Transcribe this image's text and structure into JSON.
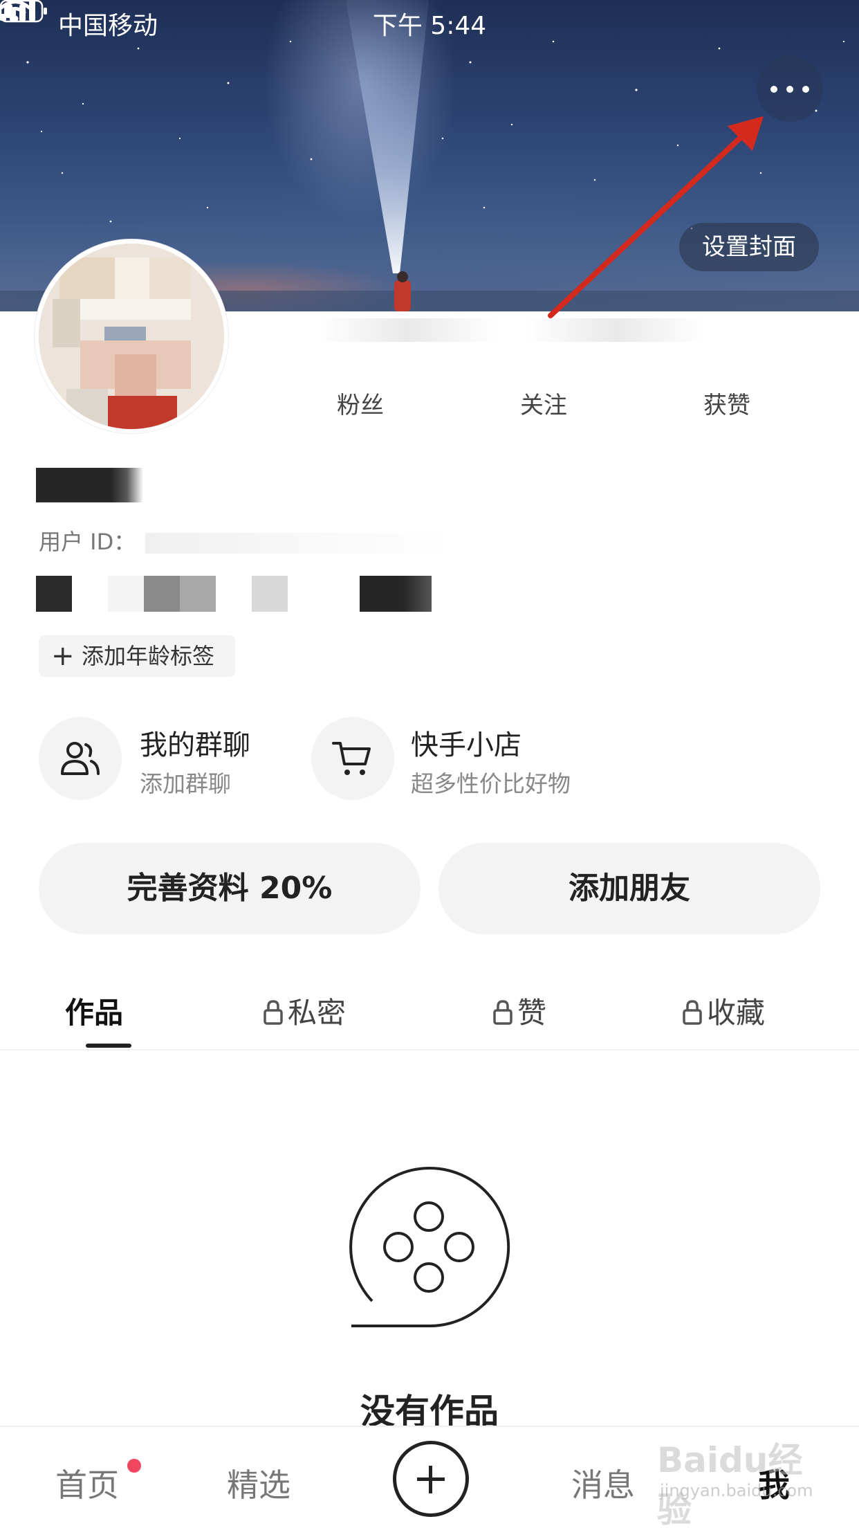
{
  "status_bar": {
    "carrier": "中国移动",
    "time": "下午 5:44"
  },
  "cover": {
    "set_cover_label": "设置封面"
  },
  "profile": {
    "stats": [
      {
        "label": "粉丝"
      },
      {
        "label": "关注"
      },
      {
        "label": "获赞"
      }
    ],
    "user_id_label": "用户 ID：",
    "add_age_tag": "添加年龄标签"
  },
  "entries": [
    {
      "title": "我的群聊",
      "subtitle": "添加群聊",
      "icon": "group-icon"
    },
    {
      "title": "快手小店",
      "subtitle": "超多性价比好物",
      "icon": "cart-icon"
    }
  ],
  "buttons": {
    "complete_profile": "完善资料 20%",
    "add_friends": "添加朋友"
  },
  "tabs": [
    {
      "label": "作品",
      "locked": false,
      "active": true
    },
    {
      "label": "私密",
      "locked": true,
      "active": false
    },
    {
      "label": "赞",
      "locked": true,
      "active": false
    },
    {
      "label": "收藏",
      "locked": true,
      "active": false
    }
  ],
  "empty_state": {
    "text": "没有作品",
    "icon": "film-reel-icon"
  },
  "bottom_nav": [
    {
      "label": "首页",
      "active": false,
      "badge": true
    },
    {
      "label": "精选",
      "active": false
    },
    {
      "label": "消息",
      "active": false
    },
    {
      "label": "我",
      "active": true
    }
  ],
  "watermark": {
    "brand": "Baidu经验",
    "url": "jingyan.baidu.com"
  },
  "colors": {
    "accent_red_dot": "#f0465f",
    "annotation_arrow": "#d42a1e"
  }
}
